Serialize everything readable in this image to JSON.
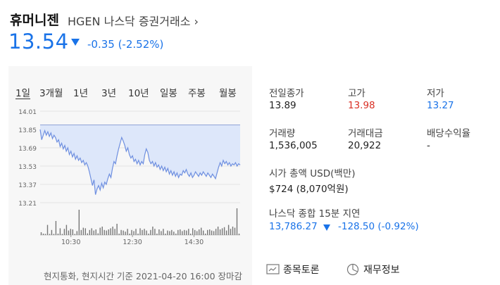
{
  "header": {
    "name": "휴머니젠",
    "ticker_line": "HGEN 나스닥 증권거래소 ›",
    "price": "13.54",
    "change": "-0.35 (-2.52%)",
    "change_direction": "down",
    "color_up": "#d93025",
    "color_down": "#1a73e8"
  },
  "range_tabs": [
    {
      "label": "1일",
      "active": true
    },
    {
      "label": "3개월",
      "active": false
    },
    {
      "label": "1년",
      "active": false
    },
    {
      "label": "3년",
      "active": false
    },
    {
      "label": "10년",
      "active": false
    },
    {
      "label": "일봉",
      "active": false
    },
    {
      "label": "주봉",
      "active": false
    },
    {
      "label": "월봉",
      "active": false
    }
  ],
  "chart_data": {
    "type": "line",
    "y_ticks": [
      "14.01",
      "13.85",
      "13.69",
      "13.53",
      "13.37",
      "13.21"
    ],
    "ylim": [
      13.21,
      14.01
    ],
    "prev_close": 13.89,
    "x_ticks": [
      "10:30",
      "12:30",
      "14:30"
    ],
    "x_tick_minutes": [
      60,
      180,
      300
    ],
    "session_minutes": 390,
    "line_color": "#6e8fe0",
    "fill_color": "#dde7fa",
    "series": [
      {
        "t": 0,
        "v": 13.85
      },
      {
        "t": 3,
        "v": 13.76
      },
      {
        "t": 6,
        "v": 13.8
      },
      {
        "t": 9,
        "v": 13.84
      },
      {
        "t": 12,
        "v": 13.8
      },
      {
        "t": 15,
        "v": 13.83
      },
      {
        "t": 18,
        "v": 13.79
      },
      {
        "t": 21,
        "v": 13.82
      },
      {
        "t": 24,
        "v": 13.77
      },
      {
        "t": 27,
        "v": 13.8
      },
      {
        "t": 30,
        "v": 13.78
      },
      {
        "t": 33,
        "v": 13.74
      },
      {
        "t": 36,
        "v": 13.76
      },
      {
        "t": 39,
        "v": 13.7
      },
      {
        "t": 42,
        "v": 13.73
      },
      {
        "t": 45,
        "v": 13.68
      },
      {
        "t": 48,
        "v": 13.71
      },
      {
        "t": 51,
        "v": 13.66
      },
      {
        "t": 54,
        "v": 13.69
      },
      {
        "t": 57,
        "v": 13.63
      },
      {
        "t": 60,
        "v": 13.66
      },
      {
        "t": 63,
        "v": 13.61
      },
      {
        "t": 66,
        "v": 13.64
      },
      {
        "t": 69,
        "v": 13.59
      },
      {
        "t": 72,
        "v": 13.62
      },
      {
        "t": 75,
        "v": 13.58
      },
      {
        "t": 78,
        "v": 13.6
      },
      {
        "t": 81,
        "v": 13.56
      },
      {
        "t": 84,
        "v": 13.58
      },
      {
        "t": 87,
        "v": 13.54
      },
      {
        "t": 90,
        "v": 13.56
      },
      {
        "t": 93,
        "v": 13.53
      },
      {
        "t": 96,
        "v": 13.48
      },
      {
        "t": 99,
        "v": 13.42
      },
      {
        "t": 102,
        "v": 13.36
      },
      {
        "t": 105,
        "v": 13.41
      },
      {
        "t": 108,
        "v": 13.28
      },
      {
        "t": 111,
        "v": 13.33
      },
      {
        "t": 114,
        "v": 13.36
      },
      {
        "t": 117,
        "v": 13.32
      },
      {
        "t": 120,
        "v": 13.38
      },
      {
        "t": 123,
        "v": 13.34
      },
      {
        "t": 126,
        "v": 13.39
      },
      {
        "t": 129,
        "v": 13.37
      },
      {
        "t": 132,
        "v": 13.42
      },
      {
        "t": 135,
        "v": 13.46
      },
      {
        "t": 138,
        "v": 13.43
      },
      {
        "t": 141,
        "v": 13.51
      },
      {
        "t": 144,
        "v": 13.57
      },
      {
        "t": 147,
        "v": 13.55
      },
      {
        "t": 150,
        "v": 13.62
      },
      {
        "t": 153,
        "v": 13.68
      },
      {
        "t": 156,
        "v": 13.73
      },
      {
        "t": 159,
        "v": 13.78
      },
      {
        "t": 162,
        "v": 13.75
      },
      {
        "t": 165,
        "v": 13.71
      },
      {
        "t": 168,
        "v": 13.66
      },
      {
        "t": 171,
        "v": 13.69
      },
      {
        "t": 174,
        "v": 13.63
      },
      {
        "t": 177,
        "v": 13.6
      },
      {
        "t": 180,
        "v": 13.62
      },
      {
        "t": 183,
        "v": 13.57
      },
      {
        "t": 186,
        "v": 13.59
      },
      {
        "t": 189,
        "v": 13.55
      },
      {
        "t": 192,
        "v": 13.58
      },
      {
        "t": 195,
        "v": 13.54
      },
      {
        "t": 198,
        "v": 13.57
      },
      {
        "t": 201,
        "v": 13.55
      },
      {
        "t": 204,
        "v": 13.63
      },
      {
        "t": 207,
        "v": 13.68
      },
      {
        "t": 210,
        "v": 13.65
      },
      {
        "t": 213,
        "v": 13.58
      },
      {
        "t": 216,
        "v": 13.55
      },
      {
        "t": 219,
        "v": 13.57
      },
      {
        "t": 222,
        "v": 13.53
      },
      {
        "t": 225,
        "v": 13.56
      },
      {
        "t": 228,
        "v": 13.52
      },
      {
        "t": 231,
        "v": 13.54
      },
      {
        "t": 234,
        "v": 13.5
      },
      {
        "t": 237,
        "v": 13.53
      },
      {
        "t": 240,
        "v": 13.49
      },
      {
        "t": 243,
        "v": 13.52
      },
      {
        "t": 246,
        "v": 13.48
      },
      {
        "t": 249,
        "v": 13.51
      },
      {
        "t": 252,
        "v": 13.46
      },
      {
        "t": 255,
        "v": 13.49
      },
      {
        "t": 258,
        "v": 13.45
      },
      {
        "t": 261,
        "v": 13.48
      },
      {
        "t": 264,
        "v": 13.44
      },
      {
        "t": 267,
        "v": 13.47
      },
      {
        "t": 270,
        "v": 13.43
      },
      {
        "t": 273,
        "v": 13.46
      },
      {
        "t": 276,
        "v": 13.45
      },
      {
        "t": 279,
        "v": 13.49
      },
      {
        "t": 282,
        "v": 13.47
      },
      {
        "t": 285,
        "v": 13.5
      },
      {
        "t": 288,
        "v": 13.46
      },
      {
        "t": 291,
        "v": 13.44
      },
      {
        "t": 294,
        "v": 13.47
      },
      {
        "t": 297,
        "v": 13.43
      },
      {
        "t": 300,
        "v": 13.45
      },
      {
        "t": 303,
        "v": 13.48
      },
      {
        "t": 306,
        "v": 13.46
      },
      {
        "t": 309,
        "v": 13.44
      },
      {
        "t": 312,
        "v": 13.47
      },
      {
        "t": 315,
        "v": 13.45
      },
      {
        "t": 318,
        "v": 13.48
      },
      {
        "t": 321,
        "v": 13.46
      },
      {
        "t": 324,
        "v": 13.44
      },
      {
        "t": 327,
        "v": 13.47
      },
      {
        "t": 330,
        "v": 13.45
      },
      {
        "t": 333,
        "v": 13.43
      },
      {
        "t": 336,
        "v": 13.46
      },
      {
        "t": 339,
        "v": 13.44
      },
      {
        "t": 342,
        "v": 13.42
      },
      {
        "t": 345,
        "v": 13.47
      },
      {
        "t": 348,
        "v": 13.52
      },
      {
        "t": 351,
        "v": 13.56
      },
      {
        "t": 354,
        "v": 13.53
      },
      {
        "t": 357,
        "v": 13.58
      },
      {
        "t": 360,
        "v": 13.55
      },
      {
        "t": 363,
        "v": 13.57
      },
      {
        "t": 366,
        "v": 13.54
      },
      {
        "t": 369,
        "v": 13.56
      },
      {
        "t": 372,
        "v": 13.53
      },
      {
        "t": 375,
        "v": 13.55
      },
      {
        "t": 378,
        "v": 13.54
      },
      {
        "t": 381,
        "v": 13.56
      },
      {
        "t": 384,
        "v": 13.53
      },
      {
        "t": 387,
        "v": 13.55
      },
      {
        "t": 390,
        "v": 13.54
      }
    ],
    "volume": [
      0.1,
      0.05,
      0.04,
      0.36,
      0.04,
      0.18,
      0.04,
      0.5,
      0.05,
      0.24,
      0.04,
      0.22,
      0.36,
      0.16,
      0.22,
      0.2,
      0.04,
      0.14,
      0.9,
      0.18,
      0.26,
      0.24,
      0.06,
      0.18,
      0.24,
      0.16,
      0.2,
      0.06,
      0.26,
      0.3,
      0.18,
      0.16,
      0.2,
      0.24,
      0.3,
      0.22,
      0.4,
      0.05,
      0.18,
      0.16,
      0.12,
      0.22,
      0.05,
      0.18,
      0.14,
      0.22,
      0.05,
      0.24,
      0.18,
      0.22,
      0.16,
      0.05,
      0.18,
      0.3,
      0.22,
      0.05,
      0.2,
      0.14,
      0.22,
      0.05,
      0.16,
      0.14,
      0.18,
      0.12,
      0.05,
      0.18,
      0.2,
      0.14,
      0.18,
      0.16,
      0.22,
      0.05,
      0.24,
      0.18,
      0.14,
      0.2,
      0.26,
      0.16,
      0.05,
      0.18,
      0.2,
      0.16,
      0.14,
      0.22,
      0.3,
      0.2,
      0.24,
      0.28,
      0.16,
      0.36,
      0.22,
      0.3,
      0.26,
      0.95,
      0.05
    ]
  },
  "stats": [
    {
      "label": "전일종가",
      "value": "13.89",
      "tone": "normal"
    },
    {
      "label": "고가",
      "value": "13.98",
      "tone": "up"
    },
    {
      "label": "저가",
      "value": "13.27",
      "tone": "down"
    },
    {
      "label": "거래량",
      "value": "1,536,005",
      "tone": "normal"
    },
    {
      "label": "거래대금",
      "value": "20,922",
      "tone": "normal"
    },
    {
      "label": "배당수익율",
      "value": "-",
      "tone": "normal"
    },
    {
      "label": "시가 총액 USD(백만)",
      "value": "$724 (8,070억원)",
      "tone": "normal"
    }
  ],
  "index": {
    "label": "나스닥 종합 15분 지연",
    "value": "13,786.27",
    "change": "-128.50 (-0.92%)"
  },
  "actions": {
    "discussion": "종목토론",
    "financials": "재무정보"
  },
  "footer": {
    "note": "현지통화, 현지시간 기준 2021-04-20 16:00 장마감"
  }
}
